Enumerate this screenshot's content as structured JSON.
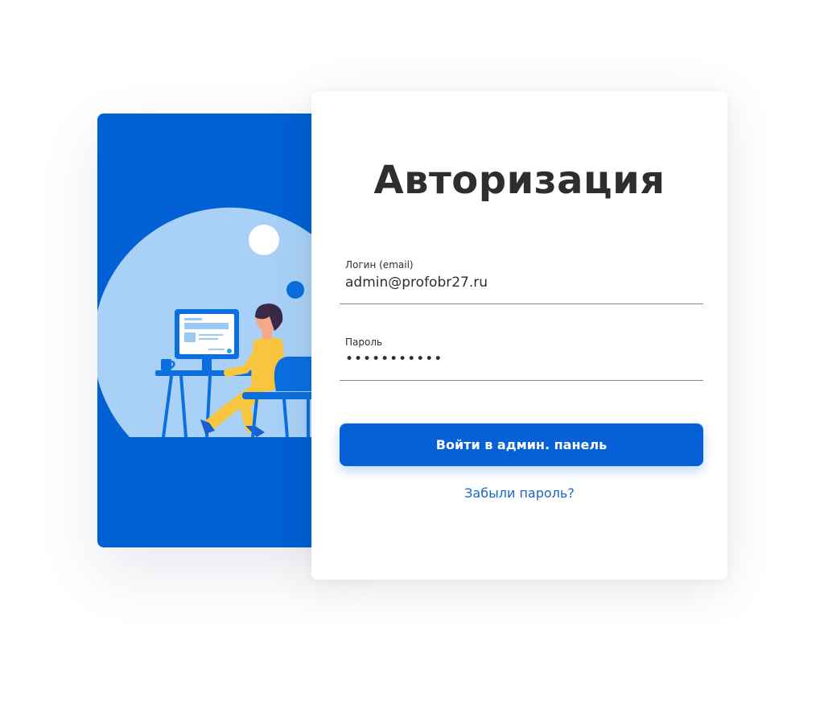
{
  "login_form": {
    "title": "Авторизация",
    "login_label": "Логин (email)",
    "login_value": "admin@profobr27.ru",
    "password_label": "Пароль",
    "password_value": "•••••••••••",
    "submit_label": "Войти в админ. панель",
    "forgot_label": "Забыли пароль?"
  },
  "colors": {
    "primary": "#0760d6",
    "panel_blue": "#0060d4",
    "link": "#1a66c4",
    "text": "#2e2e2e",
    "illustration_light_blue": "#a9d1f7",
    "person_yellow": "#f7c63e"
  },
  "illustration": {
    "subject": "person-working-at-computer-illustration"
  }
}
